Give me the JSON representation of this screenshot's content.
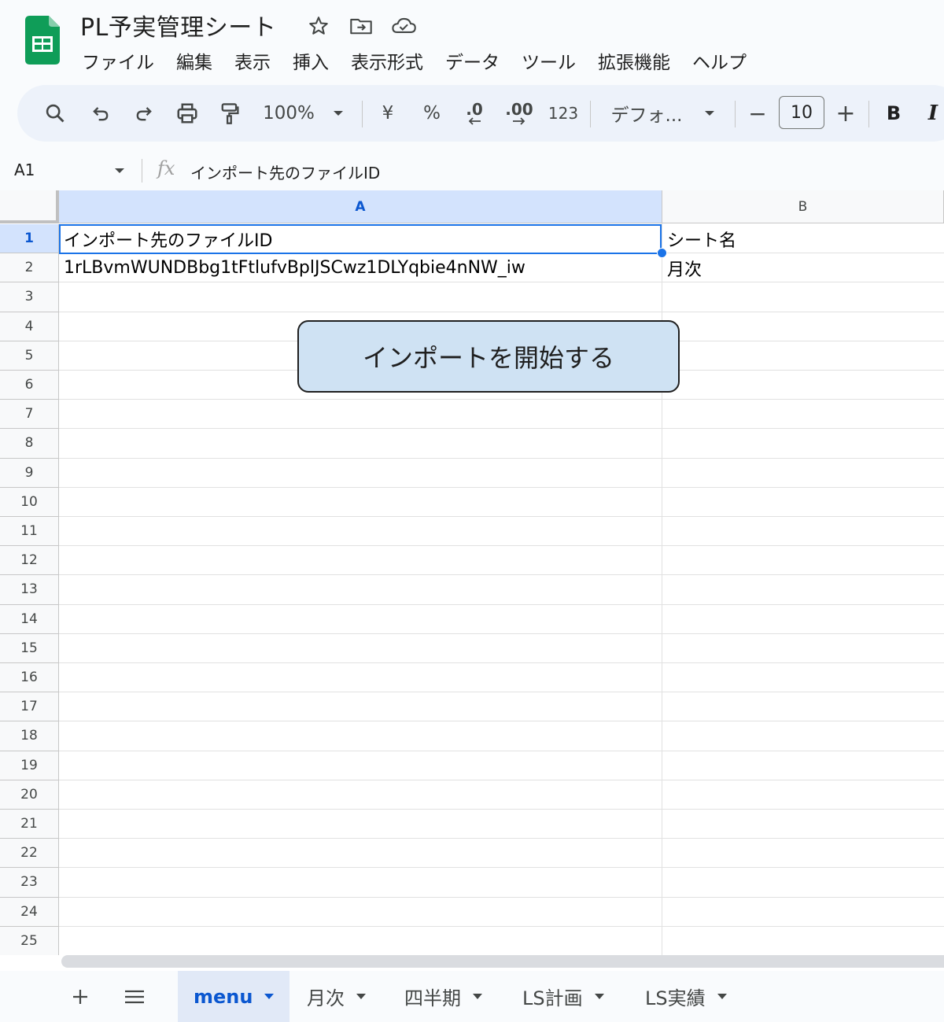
{
  "app": {
    "doc_title": "PL予実管理シート",
    "menu": [
      "ファイル",
      "編集",
      "表示",
      "挿入",
      "表示形式",
      "データ",
      "ツール",
      "拡張機能",
      "ヘルプ"
    ]
  },
  "toolbar": {
    "zoom": "100%",
    "currency": "¥",
    "percent": "%",
    "decrease_decimal": ".0",
    "increase_decimal": ".00",
    "number_format": "123",
    "font": "デフォ...",
    "minus": "−",
    "font_size": "10",
    "plus": "+",
    "bold": "B",
    "italic": "I"
  },
  "formula_bar": {
    "cell_ref": "A1",
    "fx": "fx",
    "content": "インポート先のファイルID"
  },
  "grid": {
    "columns": [
      "A",
      "B"
    ],
    "rows": [
      "1",
      "2",
      "3",
      "4",
      "5",
      "6",
      "7",
      "8",
      "9",
      "10",
      "11",
      "12",
      "13",
      "14",
      "15",
      "16",
      "17",
      "18",
      "19",
      "20",
      "21",
      "22",
      "23",
      "24",
      "25"
    ],
    "cells": {
      "A1": "インポート先のファイルID",
      "B1": "シート名",
      "A2": "1rLBvmWUNDBbg1tFtlufvBplJSCwz1DLYqbie4nNW_iw",
      "B2": "月次"
    }
  },
  "import_button": {
    "label": "インポートを開始する"
  },
  "sheet_tabs": [
    {
      "label": "menu",
      "active": true
    },
    {
      "label": "月次",
      "active": false
    },
    {
      "label": "四半期",
      "active": false
    },
    {
      "label": "LS計画",
      "active": false
    },
    {
      "label": "LS実績",
      "active": false
    }
  ],
  "colors": {
    "accent": "#1a73e8",
    "sheets_green": "#0f9d58",
    "button_fill": "#cfe2f3",
    "header_selected": "#d3e3fd"
  }
}
